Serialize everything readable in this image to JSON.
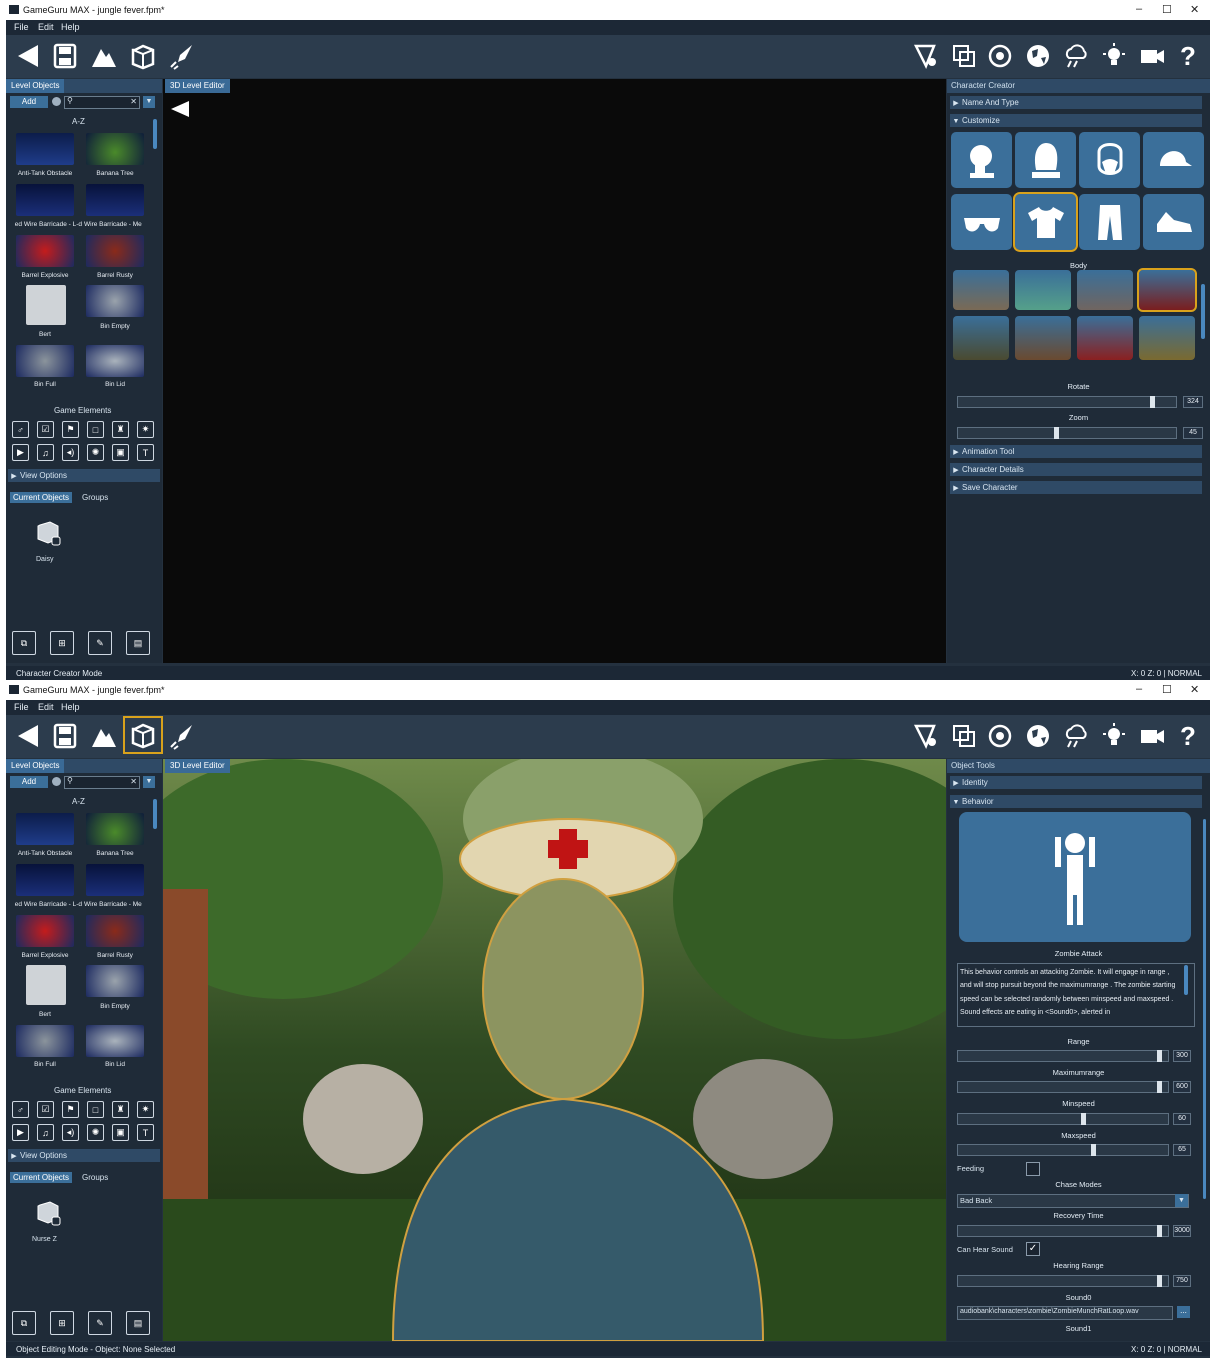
{
  "top": {
    "window_title": "GameGuru MAX - jungle fever.fpm*",
    "window_controls": [
      "–",
      "☐",
      "✕"
    ],
    "menu": [
      "File",
      "Edit",
      "Help"
    ],
    "left_panel": {
      "title": "Level Objects",
      "add_label": "Add",
      "sort_label": "A-Z",
      "items": [
        "Anti-Tank Obstacle",
        "Banana Tree",
        "ed Wire Barricade - L-d",
        "Wire Barricade - Me",
        "Barrel Explosive",
        "Barrel Rusty",
        "Bert",
        "Bin Empty",
        "Bin Full",
        "Bin Lid"
      ],
      "game_elements_label": "Game Elements",
      "view_options_label": "View Options",
      "tabs": [
        "Current Objects",
        "Groups"
      ],
      "current_object": "Daisy"
    },
    "viewport_label": "3D Level Editor",
    "right_panel": {
      "title": "Character Creator",
      "sections": {
        "name_and_type": "Name And Type",
        "customize": "Customize",
        "animation_tool": "Animation Tool",
        "character_details": "Character Details",
        "save_character": "Save Character"
      },
      "body_label": "Body",
      "rotate_label": "Rotate",
      "rotate_value": "324",
      "rotate_fraction": 0.9,
      "zoom_label": "Zoom",
      "zoom_value": "45",
      "zoom_fraction": 0.45
    },
    "status_left": "Character Creator Mode",
    "status_right": "X: 0 Z: 0 | NORMAL"
  },
  "bottom": {
    "window_title": "GameGuru MAX - jungle fever.fpm*",
    "window_controls": [
      "–",
      "☐",
      "✕"
    ],
    "menu": [
      "File",
      "Edit",
      "Help"
    ],
    "left_panel": {
      "title": "Level Objects",
      "add_label": "Add",
      "sort_label": "A-Z",
      "items": [
        "Anti-Tank Obstacle",
        "Banana Tree",
        "ed Wire Barricade - L-d",
        "Wire Barricade - Me",
        "Barrel Explosive",
        "Barrel Rusty",
        "Bert",
        "Bin Empty",
        "Bin Full",
        "Bin Lid"
      ],
      "game_elements_label": "Game Elements",
      "view_options_label": "View Options",
      "tabs": [
        "Current Objects",
        "Groups"
      ],
      "current_object": "Nurse Z"
    },
    "viewport_label": "3D Level Editor",
    "right_panel": {
      "title": "Object Tools",
      "sections": {
        "identity": "Identity",
        "behavior": "Behavior"
      },
      "behavior_name": "Zombie Attack",
      "description": "This behavior controls an attacking Zombie. It will engage in range , and will stop pursuit beyond the maximumrange . The zombie starting speed can be selected randomly between minspeed and maxspeed . Sound effects are eating in <Sound0>, alerted in",
      "range_label": "Range",
      "range_value": "300",
      "range_fraction": 0.97,
      "maxrange_label": "Maximumrange",
      "maxrange_value": "600",
      "maxrange_fraction": 0.97,
      "minspeed_label": "Minspeed",
      "minspeed_value": "60",
      "minspeed_fraction": 0.6,
      "maxspeed_label": "Maxspeed",
      "maxspeed_value": "65",
      "maxspeed_fraction": 0.65,
      "feeding_label": "Feeding",
      "chase_label": "Chase Modes",
      "chase_value": "Bad Back",
      "recovery_label": "Recovery Time",
      "recovery_value": "3000",
      "recovery_fraction": 0.97,
      "can_hear_label": "Can Hear Sound",
      "hearing_label": "Hearing Range",
      "hearing_value": "750",
      "hearing_fraction": 0.97,
      "sound0_label": "Sound0",
      "sound0_value": "audiobank\\characters\\zombie\\ZombieMunchRatLoop.wav",
      "sound1_label": "Sound1",
      "browse_label": "..."
    },
    "status_left": "Object Editing Mode - Object: None Selected",
    "status_right": "X: 0 Z: 0 | NORMAL"
  },
  "colors": {
    "accent": "#d9a21c",
    "panel_blue": "#3b6f9a",
    "header_blue": "#2f4a66",
    "background": "#24313f"
  },
  "icons": [
    "back-icon",
    "save-icon",
    "terrain-icon",
    "object-cube-icon",
    "test-game-icon",
    "settings-icon",
    "map-icon",
    "target-icon",
    "globe-icon",
    "weather-icon",
    "light-icon",
    "camera-icon",
    "help-icon"
  ]
}
